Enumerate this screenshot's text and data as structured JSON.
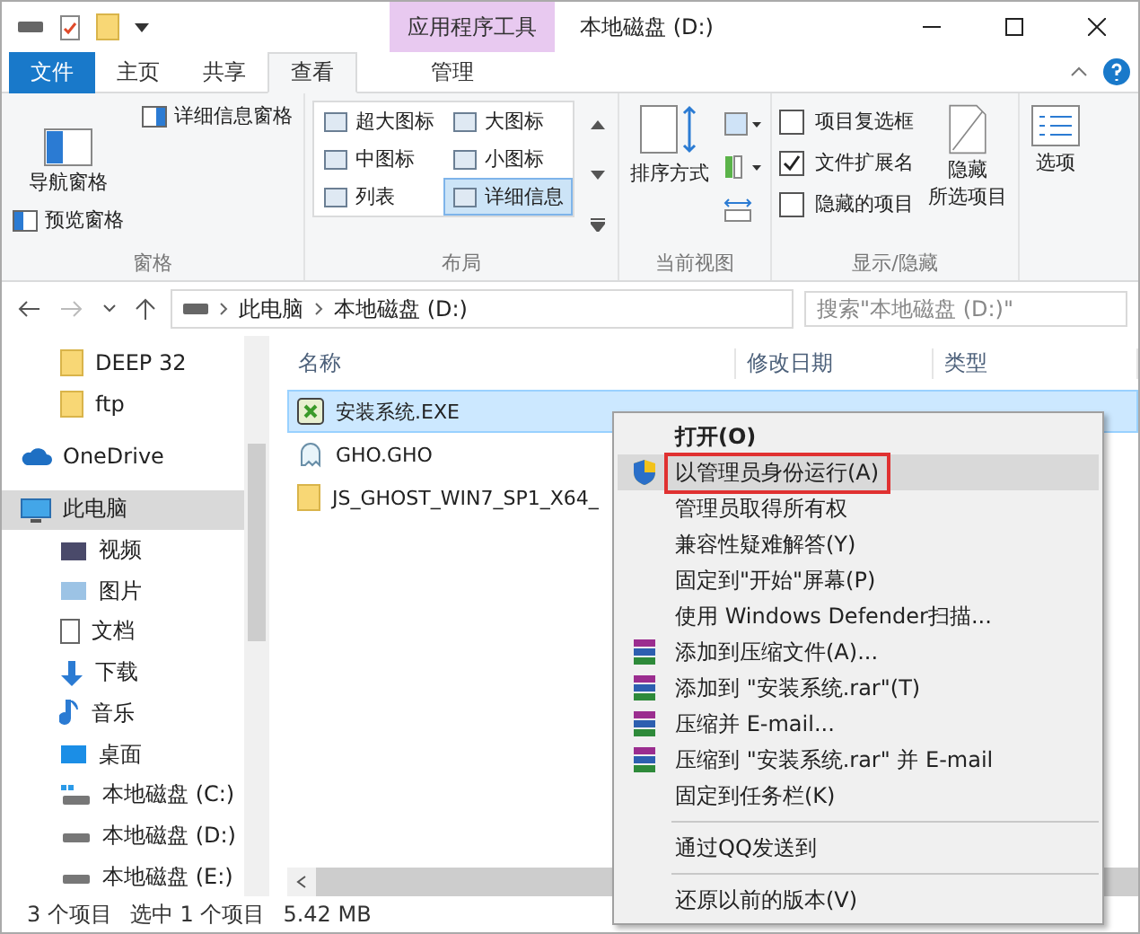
{
  "window": {
    "title": "本地磁盘 (D:)",
    "context_group": "应用程序工具"
  },
  "tabs": [
    {
      "label": "文件",
      "kind": "file",
      "selected": false
    },
    {
      "label": "主页",
      "kind": "normal",
      "selected": false
    },
    {
      "label": "共享",
      "kind": "normal",
      "selected": false
    },
    {
      "label": "查看",
      "kind": "normal",
      "selected": true
    },
    {
      "label": "管理",
      "kind": "context",
      "selected": false
    }
  ],
  "ribbon": {
    "pane": {
      "navigation": "导航窗格",
      "preview": "预览窗格",
      "details": "详细信息窗格",
      "caption": "窗格"
    },
    "layout": {
      "items": [
        {
          "label": "超大图标",
          "selected": false
        },
        {
          "label": "大图标",
          "selected": false
        },
        {
          "label": "中图标",
          "selected": false
        },
        {
          "label": "小图标",
          "selected": false
        },
        {
          "label": "列表",
          "selected": false
        },
        {
          "label": "详细信息",
          "selected": true
        }
      ],
      "caption": "布局"
    },
    "current_view": {
      "sort": "排序方式",
      "caption": "当前视图"
    },
    "show_hide": {
      "checkboxes": [
        {
          "label": "项目复选框",
          "checked": false
        },
        {
          "label": "文件扩展名",
          "checked": true
        },
        {
          "label": "隐藏的项目",
          "checked": false
        }
      ],
      "hide_lines": [
        "隐藏",
        "所选项目"
      ],
      "caption": "显示/隐藏"
    },
    "options": "选项"
  },
  "address": {
    "crumbs": [
      "此电脑",
      "本地磁盘 (D:)"
    ],
    "search_placeholder": "搜索\"本地磁盘 (D:)\""
  },
  "sidebar": {
    "loose_items": [
      {
        "label": "DEEP 32"
      },
      {
        "label": "ftp"
      }
    ],
    "items": [
      {
        "label": "OneDrive",
        "kind": "cloud",
        "selected": false
      },
      {
        "label": "此电脑",
        "kind": "pc",
        "selected": true,
        "children": [
          {
            "label": "视频",
            "kind": "video",
            "selected": false
          },
          {
            "label": "图片",
            "kind": "picture",
            "selected": false
          },
          {
            "label": "文档",
            "kind": "doc",
            "selected": false
          },
          {
            "label": "下载",
            "kind": "download",
            "selected": false
          },
          {
            "label": "音乐",
            "kind": "music",
            "selected": false
          },
          {
            "label": "桌面",
            "kind": "desktop",
            "selected": false
          },
          {
            "label": "本地磁盘 (C:)",
            "kind": "sysdrive",
            "selected": false
          },
          {
            "label": "本地磁盘 (D:)",
            "kind": "drive",
            "selected": false
          },
          {
            "label": "本地磁盘 (E:)",
            "kind": "drive",
            "selected": false
          }
        ]
      }
    ]
  },
  "table": {
    "columns": [
      "名称",
      "修改日期",
      "类型"
    ],
    "rows": [
      {
        "name": "安装系统.EXE",
        "kind": "exe",
        "selected": true
      },
      {
        "name": "GHO.GHO",
        "kind": "gho",
        "selected": false
      },
      {
        "name": "JS_GHOST_WIN7_SP1_X64_",
        "kind": "folder",
        "selected": false
      }
    ]
  },
  "context_menu": [
    {
      "label": "打开(O)",
      "kind": "default",
      "selected": false
    },
    {
      "label": "以管理员身份运行(A)",
      "kind": "shield",
      "selected": true,
      "outlined": true
    },
    {
      "label": "管理员取得所有权",
      "kind": "plain",
      "selected": false
    },
    {
      "label": "兼容性疑难解答(Y)",
      "kind": "plain",
      "selected": false
    },
    {
      "label": "固定到\"开始\"屏幕(P)",
      "kind": "plain",
      "selected": false
    },
    {
      "label": "使用 Windows Defender扫描...",
      "kind": "plain",
      "selected": false
    },
    {
      "label": "添加到压缩文件(A)...",
      "kind": "archive",
      "selected": false
    },
    {
      "label": "添加到 \"安装系统.rar\"(T)",
      "kind": "archive",
      "selected": false
    },
    {
      "label": "压缩并 E-mail...",
      "kind": "archive",
      "selected": false
    },
    {
      "label": "压缩到 \"安装系统.rar\" 并 E-mail",
      "kind": "archive",
      "selected": false
    },
    {
      "label": "固定到任务栏(K)",
      "kind": "plain",
      "selected": false
    },
    {
      "kind": "separator"
    },
    {
      "label": "通过QQ发送到",
      "kind": "plain",
      "selected": false
    },
    {
      "kind": "separator"
    },
    {
      "label": "还原以前的版本(V)",
      "kind": "plain",
      "selected": false
    }
  ],
  "status_bar": {
    "count": "3 个项目",
    "selection": "选中 1 个项目",
    "size": "5.42 MB"
  }
}
